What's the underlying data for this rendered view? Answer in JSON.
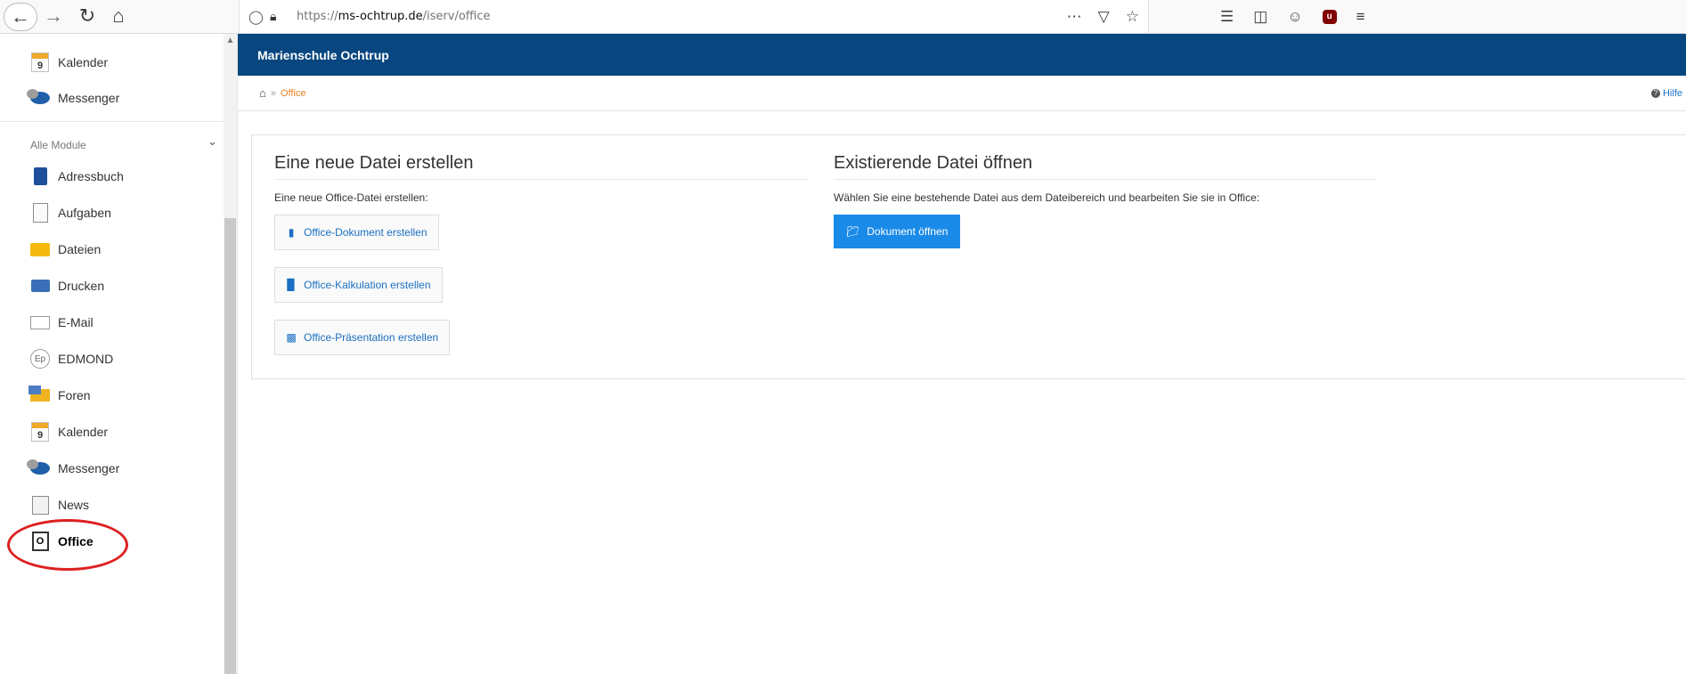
{
  "browser": {
    "url_prefix": "https://",
    "url_domain": "ms-ochtrup.de",
    "url_path": "/iserv/office",
    "icons": [
      "back-arrow-icon",
      "forward-arrow-icon",
      "reload-icon",
      "home-icon",
      "shield-icon",
      "lock-icon",
      "more-icon",
      "pocket-icon",
      "star-icon",
      "library-icon",
      "sidebar-icon",
      "account-icon",
      "ublock-icon",
      "menu-icon"
    ]
  },
  "sidebar": {
    "top_items": [
      {
        "label": "Kalender",
        "icon": "calendar-icon"
      },
      {
        "label": "Messenger",
        "icon": "messenger-icon"
      }
    ],
    "section_label": "Alle Module",
    "items": [
      {
        "label": "Adressbuch",
        "icon": "addressbook-icon"
      },
      {
        "label": "Aufgaben",
        "icon": "tasks-icon"
      },
      {
        "label": "Dateien",
        "icon": "folder-icon"
      },
      {
        "label": "Drucken",
        "icon": "printer-icon"
      },
      {
        "label": "E-Mail",
        "icon": "mail-icon"
      },
      {
        "label": "EDMOND",
        "icon": "edmond-icon"
      },
      {
        "label": "Foren",
        "icon": "forum-icon"
      },
      {
        "label": "Kalender",
        "icon": "calendar-icon"
      },
      {
        "label": "Messenger",
        "icon": "messenger-icon"
      },
      {
        "label": "News",
        "icon": "news-icon"
      },
      {
        "label": "Office",
        "icon": "office-icon"
      }
    ],
    "calendar_day": "9",
    "office_letter": "O",
    "edmond_letters": "Ep"
  },
  "header": {
    "school": "Marienschule Ochtrup"
  },
  "breadcrumb": {
    "sep": "»",
    "current": "Office",
    "help": "Hilfe"
  },
  "create": {
    "title": "Eine neue Datei erstellen",
    "desc": "Eine neue Office-Datei erstellen:",
    "doc_button": "Office-Dokument erstellen",
    "calc_button": "Office-Kalkulation erstellen",
    "pres_button": "Office-Präsentation erstellen"
  },
  "open": {
    "title": "Existierende Datei öffnen",
    "desc": "Wählen Sie eine bestehende Datei aus dem Dateibereich und bearbeiten Sie sie in Office:",
    "button": "Dokument öffnen"
  },
  "colors": {
    "header_bg": "#07467f",
    "link_blue": "#1a6fc2",
    "primary_button": "#1a8ae8",
    "breadcrumb_orange": "#e88321",
    "highlight_red": "#dd1f1f"
  }
}
